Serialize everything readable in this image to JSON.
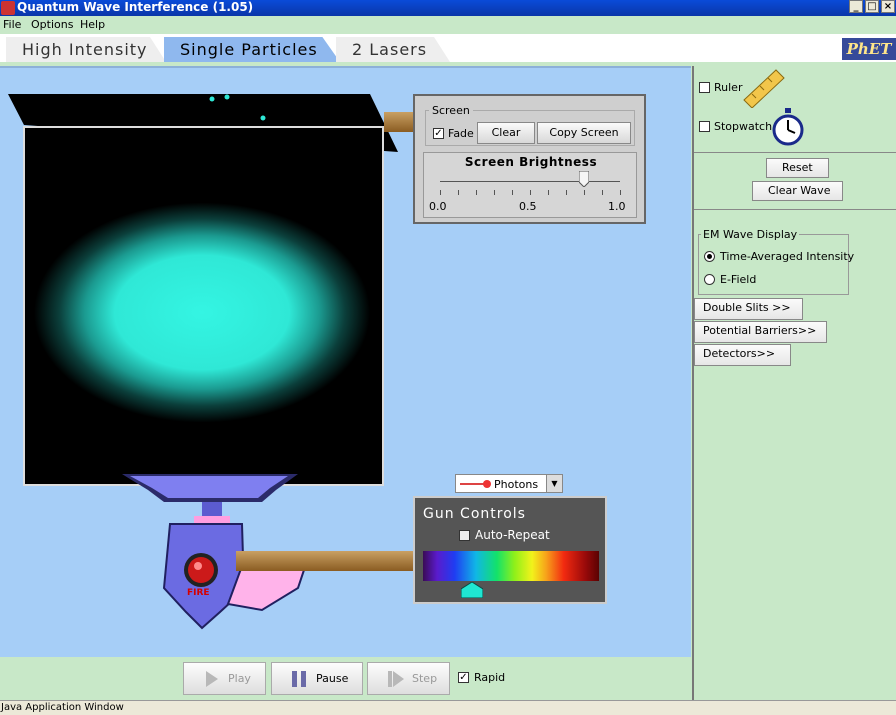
{
  "window": {
    "title": "Quantum Wave Interference (1.05)",
    "minimize": "_",
    "maximize": "□",
    "close": "×"
  },
  "menu": [
    "File",
    "Options",
    "Help"
  ],
  "tabs": [
    {
      "label": "High Intensity",
      "active": false
    },
    {
      "label": "Single Particles",
      "active": true
    },
    {
      "label": "2 Lasers",
      "active": false
    }
  ],
  "logo": "PhET",
  "screen_panel": {
    "group_label": "Screen",
    "fade_label": "Fade",
    "fade_checked": true,
    "clear_label": "Clear",
    "copy_label": "Copy Screen",
    "brightness_title": "Screen Brightness",
    "ticks": [
      "0.0",
      "0.5",
      "1.0"
    ],
    "brightness_value": 0.8
  },
  "gun": {
    "particle_select": "Photons",
    "controls_title": "Gun Controls",
    "auto_repeat_label": "Auto-Repeat",
    "auto_repeat_checked": false,
    "fire_label": "FIRE",
    "wavelength_fraction": 0.28
  },
  "playback": {
    "play_label": "Play",
    "pause_label": "Pause",
    "step_label": "Step",
    "rapid_label": "Rapid",
    "rapid_checked": true
  },
  "right_panel": {
    "ruler_label": "Ruler",
    "stopwatch_label": "Stopwatch",
    "reset_label": "Reset",
    "clear_wave_label": "Clear Wave",
    "em_title": "EM Wave Display",
    "em_options": [
      "Time-Averaged Intensity",
      "E-Field"
    ],
    "em_selected": 0,
    "double_slits": "Double Slits >>",
    "potential_barriers": "Potential Barriers>>",
    "detectors": "Detectors>>"
  },
  "status": "Java Application Window",
  "colors": {
    "stage_bg": "#a6cef7",
    "panel_bg": "#c8e8c8",
    "glow": "#34f5e3"
  }
}
